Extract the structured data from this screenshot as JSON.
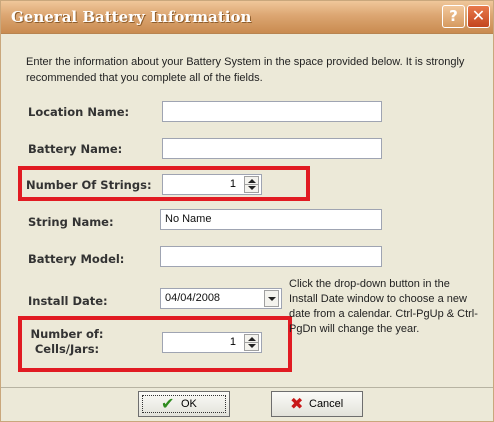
{
  "window": {
    "title": "General Battery Information",
    "help_glyph": "?",
    "close_glyph": "✕"
  },
  "instructions": "Enter the information about your Battery System in the space provided below. It is strongly recommended that you complete all of the fields.",
  "fields": {
    "location_name": {
      "label": "Location Name:",
      "value": ""
    },
    "battery_name": {
      "label": "Battery Name:",
      "value": ""
    },
    "number_of_strings": {
      "label": "Number Of Strings:",
      "value": "1"
    },
    "string_name": {
      "label": "String Name:",
      "value": "No Name"
    },
    "battery_model": {
      "label": "Battery Model:",
      "value": ""
    },
    "install_date": {
      "label": "Install Date:",
      "value": "04/04/2008"
    },
    "cells_jars": {
      "label_line1": "Number of:",
      "label_line2": "Cells/Jars:",
      "value": "1"
    }
  },
  "hint": "Click the drop-down button in the Install Date window to choose a new date from a calendar. Ctrl-PgUp & Ctrl-PgDn will change the year.",
  "buttons": {
    "ok_label": "OK",
    "ok_icon": "✔",
    "cancel_label": "Cancel",
    "cancel_icon": "✖"
  },
  "colors": {
    "titlebar": "#dca672",
    "highlight_box": "#e11b22",
    "ok_icon": "#2e8b1f",
    "cancel_icon": "#c81818"
  }
}
